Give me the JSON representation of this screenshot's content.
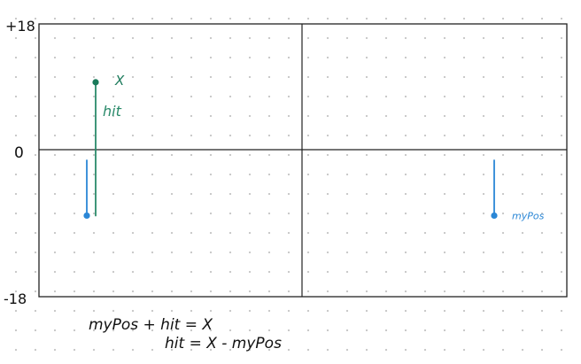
{
  "axis": {
    "top_label": "+18",
    "zero_label": "0",
    "bottom_label": "-18",
    "y_range": [
      -18,
      18
    ]
  },
  "points": {
    "x": {
      "label": "X",
      "value": 10.3,
      "color": "#1a7a5a"
    },
    "mypos": {
      "label": "myPos",
      "value": -7.3,
      "color": "#2b87d6"
    }
  },
  "vectors": {
    "hit": {
      "label": "hit",
      "color": "#2a8a6a"
    }
  },
  "equations": {
    "line1": "myPos + hit = X",
    "line2": "hit = X - myPos"
  },
  "colors": {
    "grid_dot": "#c4c4c4",
    "frame": "#222222",
    "text": "#111111",
    "blue": "#2b87d6",
    "green": "#1a7a5a"
  }
}
